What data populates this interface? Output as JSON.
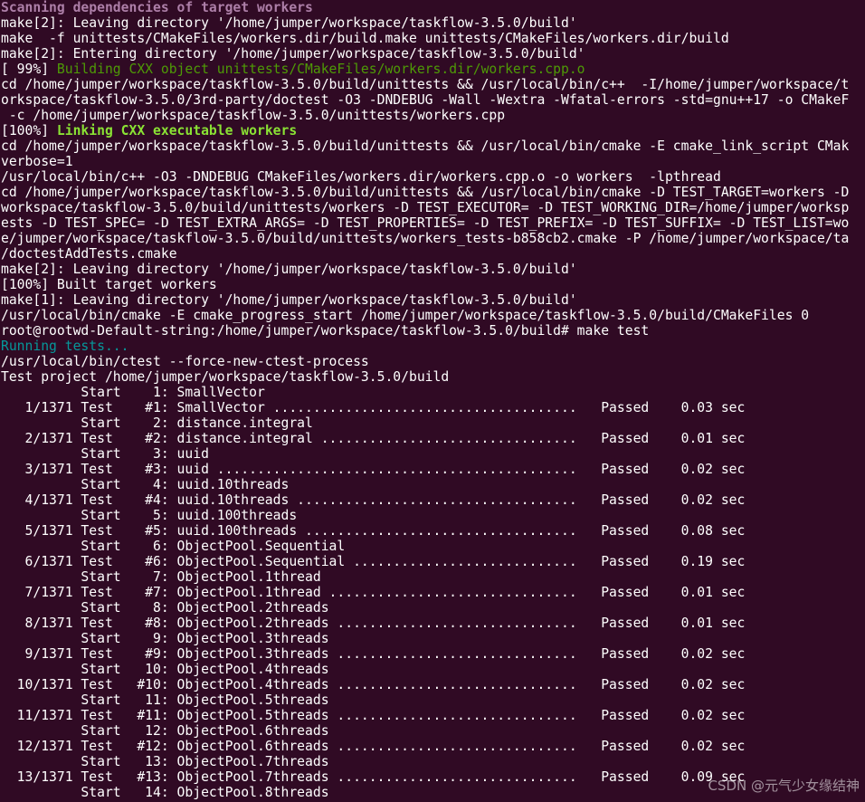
{
  "terminal": {
    "lines": [
      {
        "text": "Scanning dependencies of target workers",
        "color": "purple"
      },
      {
        "text": "make[2]: Leaving directory '/home/jumper/workspace/taskflow-3.5.0/build'",
        "color": "white"
      },
      {
        "text": "make  -f unittests/CMakeFiles/workers.dir/build.make unittests/CMakeFiles/workers.dir/build",
        "color": "white"
      },
      {
        "text": "make[2]: Entering directory '/home/jumper/workspace/taskflow-3.5.0/build'",
        "color": "white"
      },
      {
        "text": "[ 99%] ",
        "color": "white",
        "suffix": "Building CXX object unittests/CMakeFiles/workers.dir/workers.cpp.o",
        "suffix_color": "green"
      },
      {
        "text": "cd /home/jumper/workspace/taskflow-3.5.0/build/unittests && /usr/local/bin/c++  -I/home/jumper/workspace/t",
        "color": "white"
      },
      {
        "text": "orkspace/taskflow-3.5.0/3rd-party/doctest -O3 -DNDEBUG -Wall -Wextra -Wfatal-errors -std=gnu++17 -o CMakeF",
        "color": "white"
      },
      {
        "text": " -c /home/jumper/workspace/taskflow-3.5.0/unittests/workers.cpp",
        "color": "white"
      },
      {
        "text": "[100%] ",
        "color": "white",
        "suffix": "Linking CXX executable workers",
        "suffix_color": "green-bold"
      },
      {
        "text": "cd /home/jumper/workspace/taskflow-3.5.0/build/unittests && /usr/local/bin/cmake -E cmake_link_script CMak",
        "color": "white"
      },
      {
        "text": "verbose=1",
        "color": "white"
      },
      {
        "text": "/usr/local/bin/c++ -O3 -DNDEBUG CMakeFiles/workers.dir/workers.cpp.o -o workers  -lpthread",
        "color": "white"
      },
      {
        "text": "cd /home/jumper/workspace/taskflow-3.5.0/build/unittests && /usr/local/bin/cmake -D TEST_TARGET=workers -D",
        "color": "white"
      },
      {
        "text": "workspace/taskflow-3.5.0/build/unittests/workers -D TEST_EXECUTOR= -D TEST_WORKING_DIR=/home/jumper/worksp",
        "color": "white"
      },
      {
        "text": "ests -D TEST_SPEC= -D TEST_EXTRA_ARGS= -D TEST_PROPERTIES= -D TEST_PREFIX= -D TEST_SUFFIX= -D TEST_LIST=wo",
        "color": "white"
      },
      {
        "text": "e/jumper/workspace/taskflow-3.5.0/build/unittests/workers_tests-b858cb2.cmake -P /home/jumper/workspace/ta",
        "color": "white"
      },
      {
        "text": "/doctestAddTests.cmake",
        "color": "white"
      },
      {
        "text": "make[2]: Leaving directory '/home/jumper/workspace/taskflow-3.5.0/build'",
        "color": "white"
      },
      {
        "text": "[100%] Built target workers",
        "color": "white"
      },
      {
        "text": "make[1]: Leaving directory '/home/jumper/workspace/taskflow-3.5.0/build'",
        "color": "white"
      },
      {
        "text": "/usr/local/bin/cmake -E cmake_progress_start /home/jumper/workspace/taskflow-3.5.0/build/CMakeFiles 0",
        "color": "white"
      },
      {
        "text": "root@rootwd-Default-string:/home/jumper/workspace/taskflow-3.5.0/build# make test",
        "color": "white"
      },
      {
        "text": "Running tests...",
        "color": "cyan"
      },
      {
        "text": "/usr/local/bin/ctest --force-new-ctest-process",
        "color": "white"
      },
      {
        "text": "Test project /home/jumper/workspace/taskflow-3.5.0/build",
        "color": "white"
      },
      {
        "text": "          Start    1: SmallVector",
        "color": "white"
      },
      {
        "text": "   1/1371 Test    #1: SmallVector ......................................   Passed    0.03 sec",
        "color": "white"
      },
      {
        "text": "          Start    2: distance.integral",
        "color": "white"
      },
      {
        "text": "   2/1371 Test    #2: distance.integral ................................   Passed    0.01 sec",
        "color": "white"
      },
      {
        "text": "          Start    3: uuid",
        "color": "white"
      },
      {
        "text": "   3/1371 Test    #3: uuid .............................................   Passed    0.02 sec",
        "color": "white"
      },
      {
        "text": "          Start    4: uuid.10threads",
        "color": "white"
      },
      {
        "text": "   4/1371 Test    #4: uuid.10threads ...................................   Passed    0.02 sec",
        "color": "white"
      },
      {
        "text": "          Start    5: uuid.100threads",
        "color": "white"
      },
      {
        "text": "   5/1371 Test    #5: uuid.100threads ..................................   Passed    0.08 sec",
        "color": "white"
      },
      {
        "text": "          Start    6: ObjectPool.Sequential",
        "color": "white"
      },
      {
        "text": "   6/1371 Test    #6: ObjectPool.Sequential ............................   Passed    0.19 sec",
        "color": "white"
      },
      {
        "text": "          Start    7: ObjectPool.1thread",
        "color": "white"
      },
      {
        "text": "   7/1371 Test    #7: ObjectPool.1thread ...............................   Passed    0.01 sec",
        "color": "white"
      },
      {
        "text": "          Start    8: ObjectPool.2threads",
        "color": "white"
      },
      {
        "text": "   8/1371 Test    #8: ObjectPool.2threads ..............................   Passed    0.01 sec",
        "color": "white"
      },
      {
        "text": "          Start    9: ObjectPool.3threads",
        "color": "white"
      },
      {
        "text": "   9/1371 Test    #9: ObjectPool.3threads ..............................   Passed    0.02 sec",
        "color": "white"
      },
      {
        "text": "          Start   10: ObjectPool.4threads",
        "color": "white"
      },
      {
        "text": "  10/1371 Test   #10: ObjectPool.4threads ..............................   Passed    0.02 sec",
        "color": "white"
      },
      {
        "text": "          Start   11: ObjectPool.5threads",
        "color": "white"
      },
      {
        "text": "  11/1371 Test   #11: ObjectPool.5threads ..............................   Passed    0.02 sec",
        "color": "white"
      },
      {
        "text": "          Start   12: ObjectPool.6threads",
        "color": "white"
      },
      {
        "text": "  12/1371 Test   #12: ObjectPool.6threads ..............................   Passed    0.02 sec",
        "color": "white"
      },
      {
        "text": "          Start   13: ObjectPool.7threads",
        "color": "white"
      },
      {
        "text": "  13/1371 Test   #13: ObjectPool.7threads ..............................   Passed    0.09 sec",
        "color": "white"
      },
      {
        "text": "          Start   14: ObjectPool.8threads",
        "color": "white"
      }
    ]
  },
  "colors": {
    "background": "#300a24",
    "purple": "#ad7fa8",
    "green": "#4e9a06",
    "green_bold": "#8ae234",
    "cyan": "#06989a"
  },
  "watermark": {
    "text": "CSDN @元气少女缘结神"
  }
}
